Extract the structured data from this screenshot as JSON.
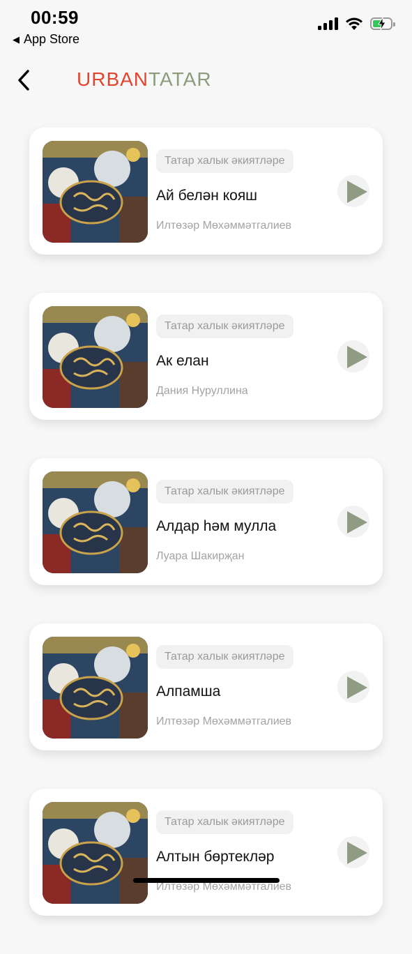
{
  "status_bar": {
    "time": "00:59",
    "back_label": "App Store"
  },
  "header": {
    "logo_part1": "URBAN",
    "logo_part2": "TATAR",
    "colors": {
      "urban": "#e2452f",
      "tatar": "#8e9a7c"
    }
  },
  "items": [
    {
      "tag": "Татар халык әкиятләре",
      "title": "Ай белән кояш",
      "author": "Илтөзәр Мөхәммәтгалиев"
    },
    {
      "tag": "Татар халык әкиятләре",
      "title": "Ак елан",
      "author": "Дания Нуруллина"
    },
    {
      "tag": "Татар халык әкиятләре",
      "title": "Алдар һәм мулла",
      "author": "Луара Шакирҗан"
    },
    {
      "tag": "Татар халык әкиятләре",
      "title": "Алпамша",
      "author": "Илтөзәр Мөхәммәтгалиев"
    },
    {
      "tag": "Татар халык әкиятләре",
      "title": "Алтын бөртекләр",
      "author": "Илтөзәр Мөхәммәтгалиев"
    }
  ],
  "icons": {
    "back": "chevron-left-icon",
    "play": "play-icon",
    "cover": "book-cover-illustration"
  }
}
